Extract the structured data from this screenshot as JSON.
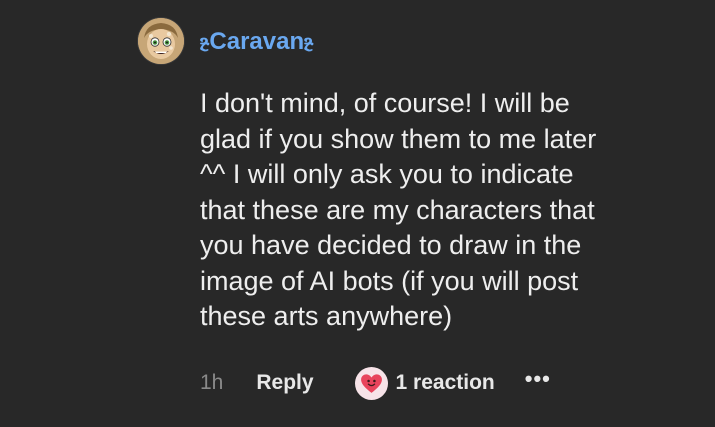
{
  "comment": {
    "author": "ⳉCaravanⳉ",
    "avatar_icon": "character-avatar",
    "author_color": "#6aa8f0",
    "body_lines": [
      "I don't mind, of course! I will be",
      "glad if you show them to me later",
      "^^ I will only ask you to indicate",
      "that these are my characters that",
      "you have decided to draw in the",
      "image of AI bots (if you will post",
      "these arts anywhere)"
    ],
    "time": "1h",
    "reply_label": "Reply",
    "reaction_icon": "heart-face-icon",
    "reaction_label": "1 reaction",
    "more_icon": "more-options-icon",
    "more_label": "•••"
  }
}
